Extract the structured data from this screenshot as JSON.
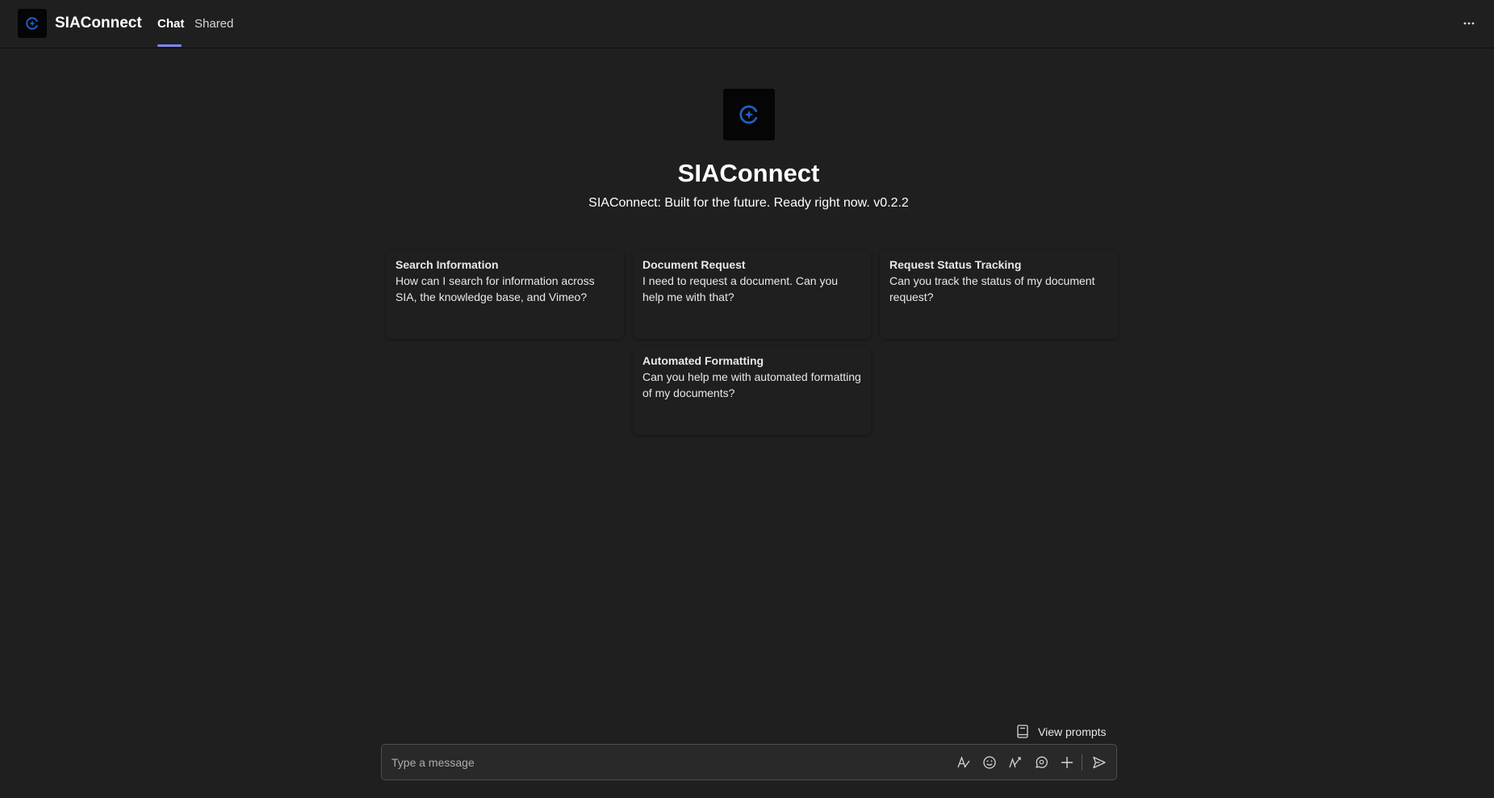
{
  "app": {
    "name": "SIAConnect",
    "logo_icon": "siaconnect-logo-icon",
    "accent_color": "#7f85f5",
    "logo_color": "#1f5fbf"
  },
  "header": {
    "tabs": [
      {
        "label": "Chat",
        "active": true
      },
      {
        "label": "Shared",
        "active": false
      }
    ],
    "more_label": "···"
  },
  "hero": {
    "title": "SIAConnect",
    "subtitle": "SIAConnect: Built for the future. Ready right now. v0.2.2"
  },
  "prompt_cards": [
    {
      "title": "Search Information",
      "description": "How can I search for information across SIA, the knowledge base, and Vimeo?"
    },
    {
      "title": "Document Request",
      "description": "I need to request a document. Can you help me with that?"
    },
    {
      "title": "Request Status Tracking",
      "description": "Can you track the status of my document request?"
    },
    {
      "title": "Automated Formatting",
      "description": "Can you help me with automated formatting of my documents?"
    }
  ],
  "view_prompts": {
    "label": "View prompts",
    "icon": "prompts-book-icon"
  },
  "composer": {
    "placeholder": "Type a message",
    "value": "",
    "tools": [
      "format-icon",
      "emoji-icon",
      "sticker-icon",
      "loop-icon",
      "add-icon",
      "send-icon"
    ]
  }
}
